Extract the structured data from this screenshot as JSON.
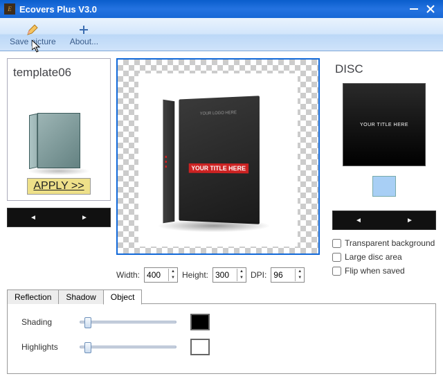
{
  "window": {
    "title": "Ecovers Plus V3.0"
  },
  "toolbar": {
    "save_label": "Save picture",
    "about_label": "About..."
  },
  "template": {
    "name": "template06",
    "apply_label": "APPLY >>"
  },
  "canvas": {
    "logo_text": "YOUR LOGO HERE",
    "title_text": "YOUR TITLE HERE"
  },
  "dims": {
    "width_label": "Width:",
    "width_value": "400",
    "height_label": "Height:",
    "height_value": "300",
    "dpi_label": "DPI:",
    "dpi_value": "96"
  },
  "disc": {
    "heading": "DISC",
    "preview_text": "YOUR TITLE HERE",
    "swatch_color": "#a8cff5"
  },
  "options": {
    "transparent_label": "Transparent background",
    "large_disc_label": "Large disc area",
    "flip_label": "Flip when saved"
  },
  "tabs": {
    "reflection": "Reflection",
    "shadow": "Shadow",
    "object": "Object",
    "active": "object"
  },
  "object_tab": {
    "shading_label": "Shading",
    "shading_color": "#000000",
    "highlights_label": "Highlights",
    "highlights_color": "#ffffff"
  }
}
